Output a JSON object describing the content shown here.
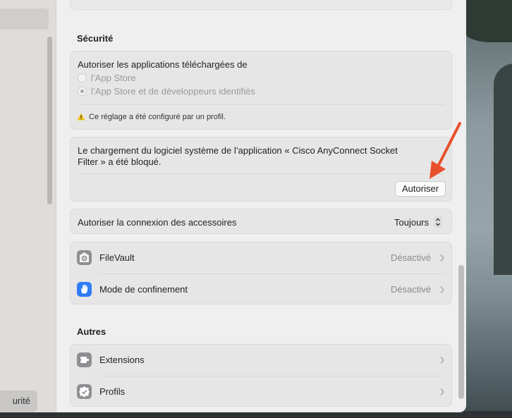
{
  "sidebar": {
    "selected_label": "urité"
  },
  "security": {
    "title": "Sécurité",
    "downloads": {
      "heading": "Autoriser les applications téléchargées de",
      "options": [
        "l’App Store",
        "l’App Store et de développeurs identifiés"
      ],
      "selected_index": 1,
      "notice": "Ce réglage a été configuré par un profil."
    },
    "blocked": {
      "line1": "Le chargement du logiciel système de l’application « Cisco AnyConnect Socket",
      "line2": "Filter » a été bloqué.",
      "allow_button": "Autoriser"
    },
    "accessories": {
      "label": "Autoriser la connexion des accessoires",
      "value": "Toujours"
    },
    "rows": [
      {
        "label": "FileVault",
        "value": "Désactivé",
        "icon": "filevault-icon"
      },
      {
        "label": "Mode de confinement",
        "value": "Désactivé",
        "icon": "hand-icon"
      }
    ]
  },
  "others": {
    "title": "Autres",
    "rows": [
      {
        "label": "Extensions",
        "icon": "extensions-icon"
      },
      {
        "label": "Profils",
        "icon": "profiles-icon"
      }
    ]
  },
  "colors": {
    "annotation_arrow": "#e8502c",
    "lockdown_blue": "#2f7cf6",
    "warning_yellow": "#f5c518"
  }
}
